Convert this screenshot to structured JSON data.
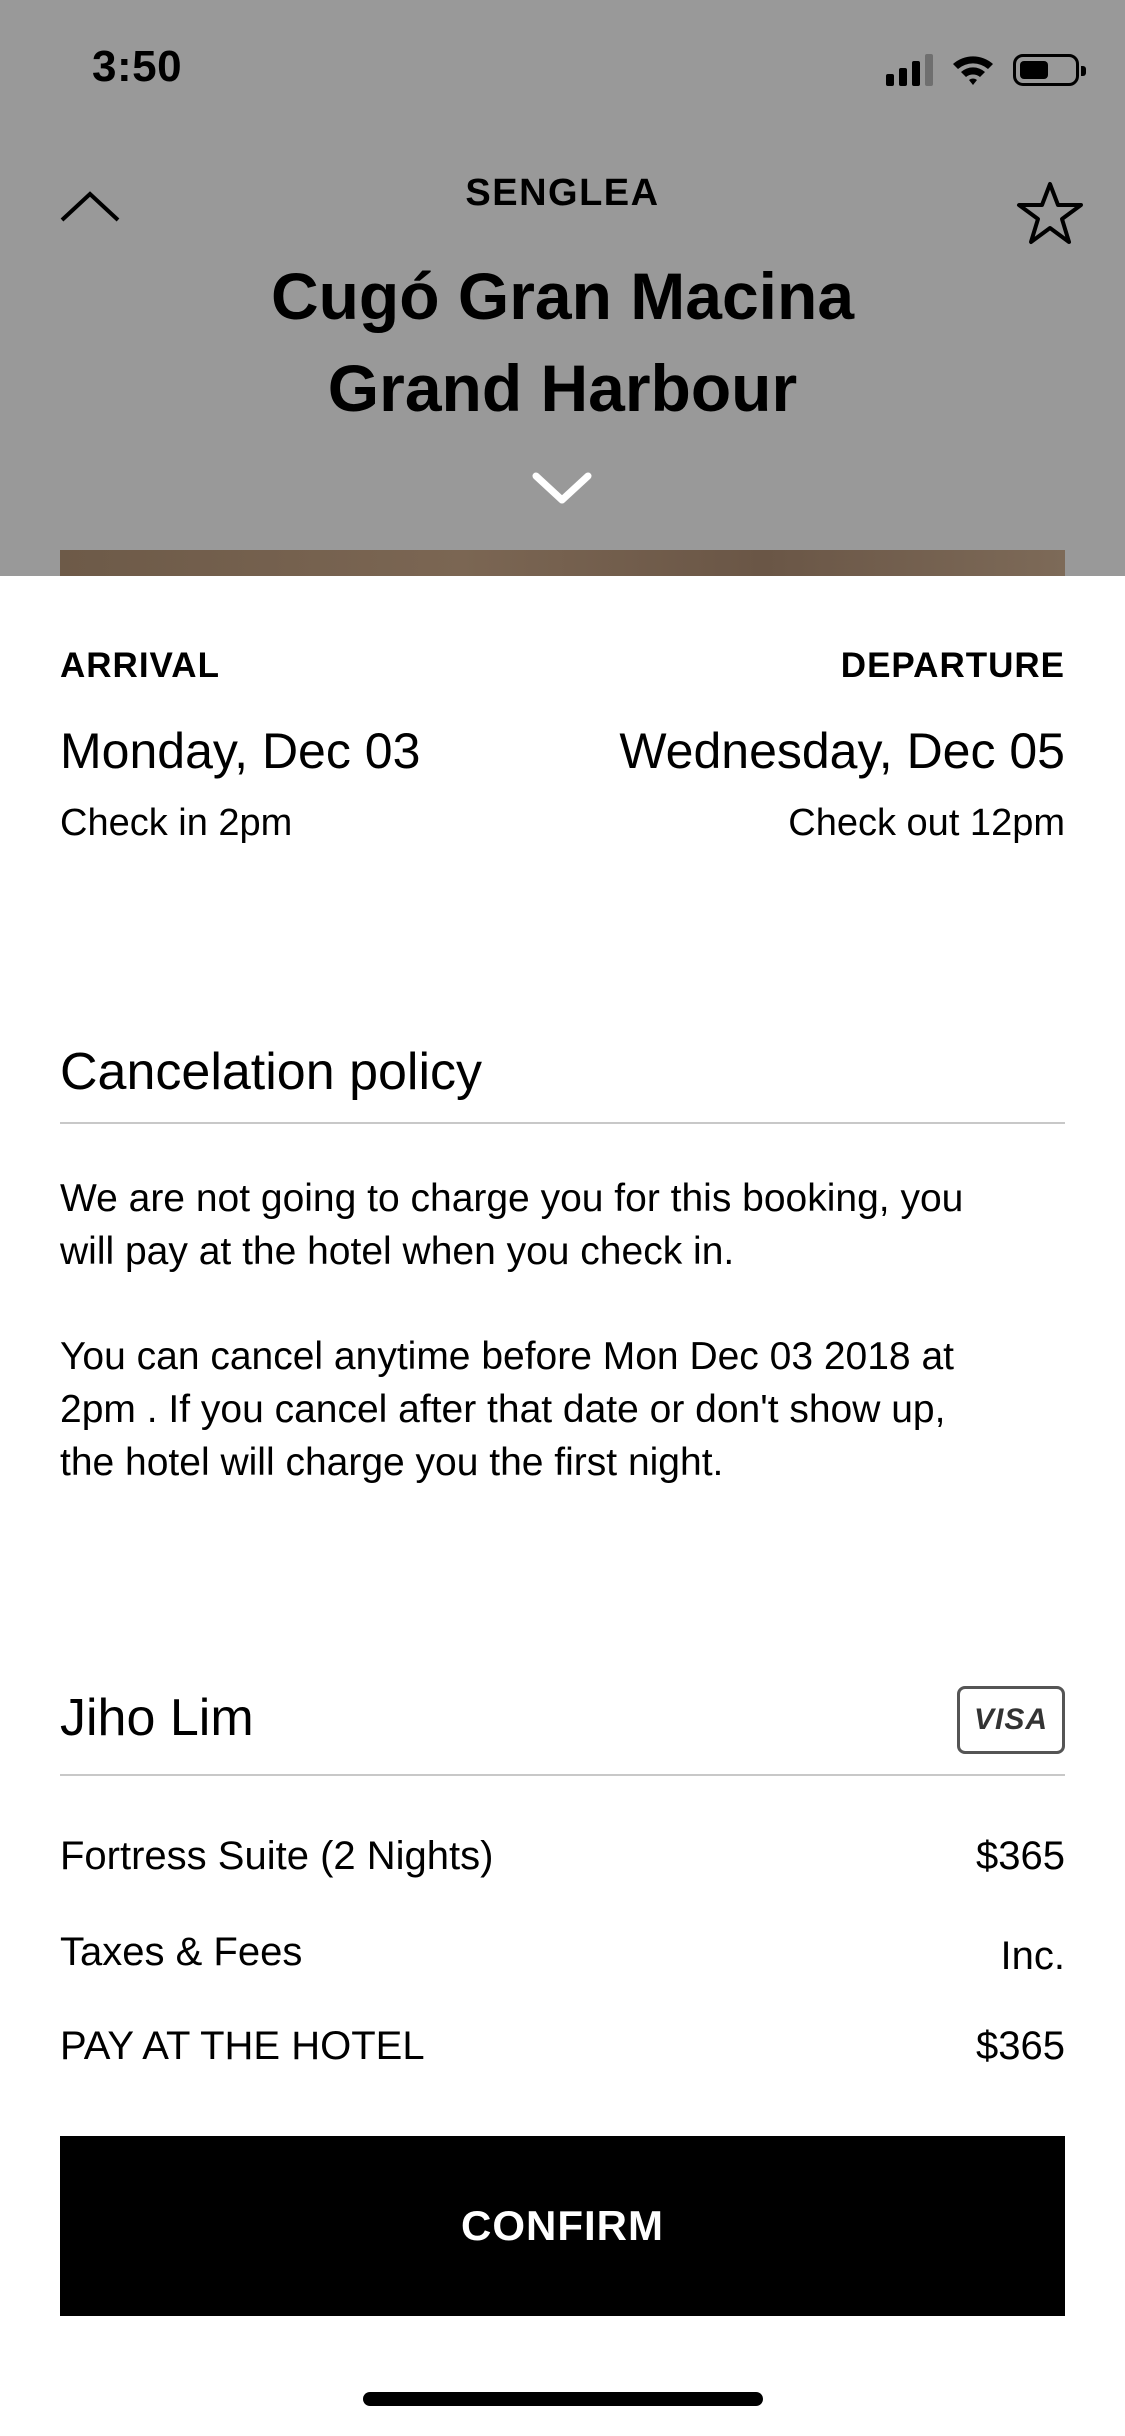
{
  "status_bar": {
    "time": "3:50"
  },
  "header": {
    "city": "SENGLEA",
    "hotel_name_line1": "Cugó Gran Macina",
    "hotel_name_line2": "Grand Harbour",
    "icons": [
      "chevron-up-icon",
      "star-icon",
      "chevron-down-icon"
    ],
    "background_color": "#999999"
  },
  "stay": {
    "arrival_label": "ARRIVAL",
    "arrival_date": "Monday, Dec 03",
    "check_in": "Check in 2pm",
    "departure_label": "DEPARTURE",
    "departure_date": "Wednesday, Dec 05",
    "check_out": "Check out 12pm"
  },
  "cancellation": {
    "title": "Cancelation policy",
    "paragraph1_line1": "We are not going to charge you for this booking, you",
    "paragraph1_line2": "will pay at the hotel when you check in.",
    "paragraph2_line1": "You can cancel anytime before Mon Dec 03 2018 at",
    "paragraph2_line2": "2pm . If you cancel after that date or don't show up,",
    "paragraph2_line3": "the hotel will charge you the first night."
  },
  "payment": {
    "guest_name": "Jiho Lim",
    "card_brand": "VISA",
    "rows": [
      {
        "label": "Fortress Suite (2 Nights)",
        "value": "$365"
      },
      {
        "label": "Taxes & Fees",
        "value": "Inc."
      },
      {
        "label": "PAY AT THE HOTEL",
        "value": "$365"
      }
    ]
  },
  "actions": {
    "confirm_label": "CONFIRM",
    "confirm_color": "#000000"
  }
}
